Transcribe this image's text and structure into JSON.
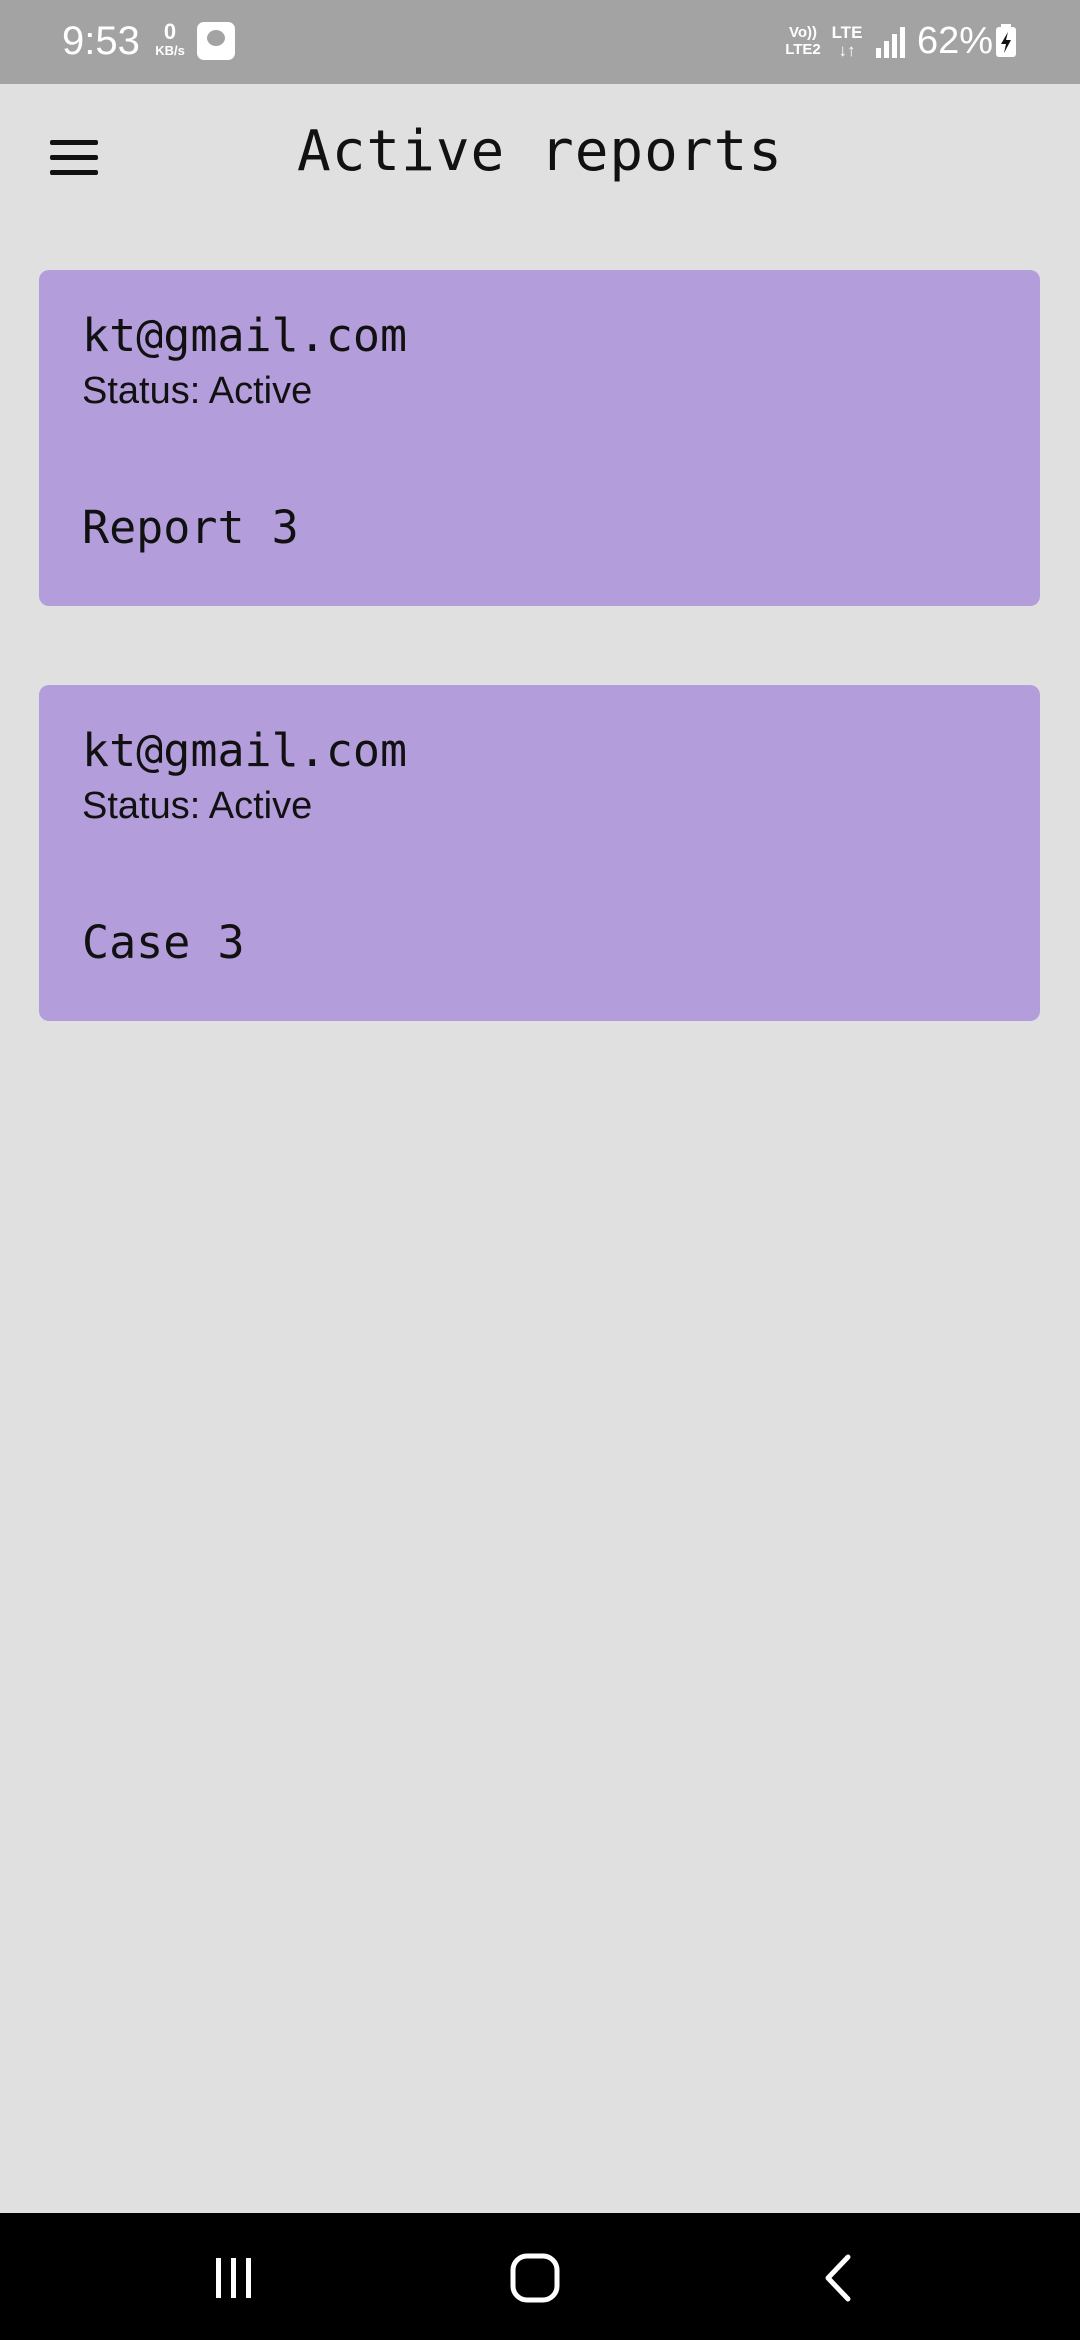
{
  "status_bar": {
    "time": "9:53",
    "net_speed_value": "0",
    "net_speed_unit": "KB/s",
    "app_icon": "gallery-app-icon",
    "volte_line1": "Vo))",
    "volte_line2": "LTE2",
    "lte_label": "LTE",
    "lte_arrows": "↓↑",
    "signal_icon": "signal-bars-icon",
    "battery_percent": "62%",
    "battery_icon": "battery-charging-icon"
  },
  "header": {
    "menu_icon": "hamburger-menu-icon",
    "title": "Active reports"
  },
  "reports": [
    {
      "email": "kt@gmail.com",
      "status": "Status: Active",
      "name": "Report 3"
    },
    {
      "email": "kt@gmail.com",
      "status": "Status: Active",
      "name": "Case 3"
    }
  ],
  "nav_bar": {
    "recents_icon": "recent-apps-icon",
    "home_icon": "home-icon",
    "back_icon": "back-icon"
  },
  "colors": {
    "background": "#e0e0e0",
    "card": "#b39ddb",
    "status_bar": "#a3a3a3",
    "nav_bar": "#000000",
    "text": "#111111"
  }
}
